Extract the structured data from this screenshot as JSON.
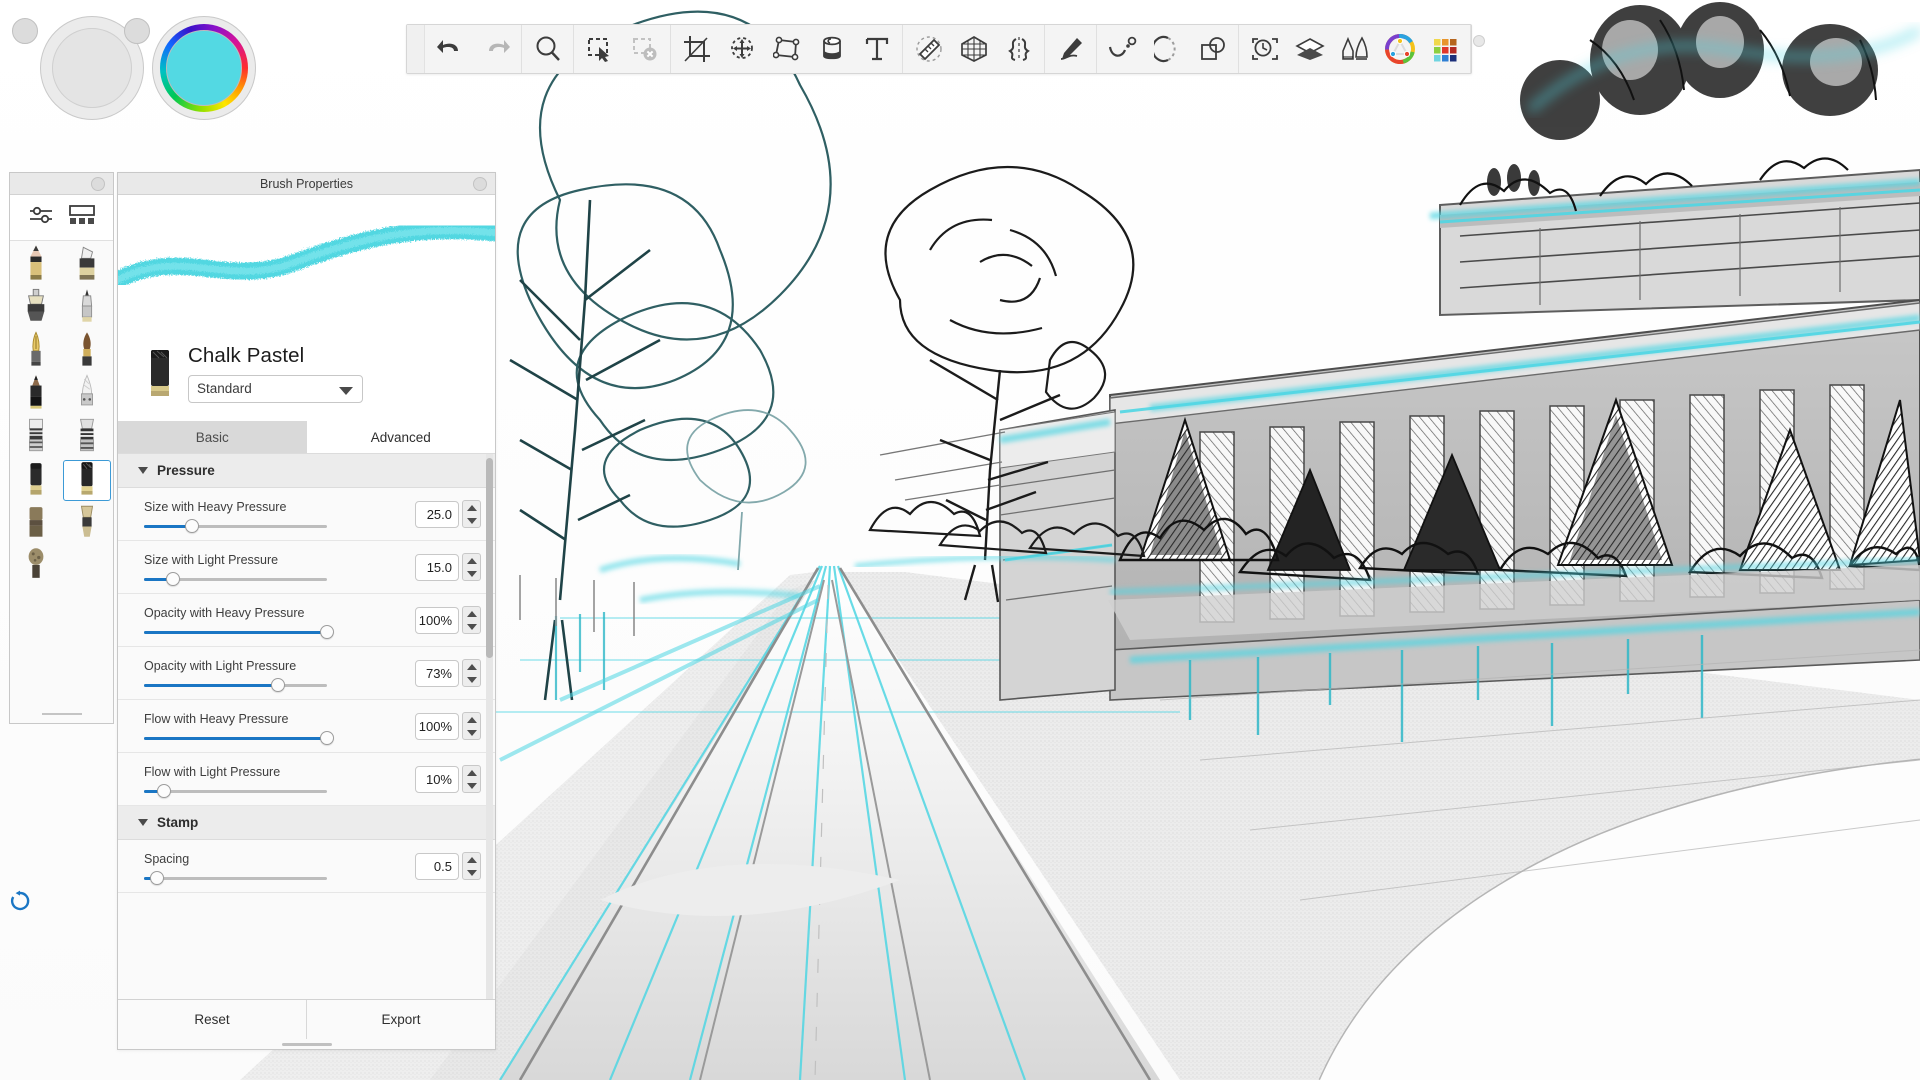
{
  "app": {
    "panel_title": "Brush Properties",
    "accent_color": "#1a76c4",
    "brush_color": "#4ad5e0"
  },
  "color_widgets": [
    {
      "name": "secondary-color-swatch",
      "color": "#e4e4e4",
      "has_ring": false
    },
    {
      "name": "primary-color-swatch",
      "color": "#53d9e3",
      "has_ring": true
    }
  ],
  "toolbar": {
    "groups": [
      {
        "items": [
          {
            "icon": "undo-icon",
            "label": "Undo"
          },
          {
            "icon": "redo-icon",
            "label": "Redo"
          }
        ]
      },
      {
        "items": [
          {
            "icon": "zoom-icon",
            "label": "Zoom"
          }
        ]
      },
      {
        "items": [
          {
            "icon": "select-icon",
            "label": "Select"
          },
          {
            "icon": "deselect-icon",
            "label": "Deselect"
          }
        ]
      },
      {
        "items": [
          {
            "icon": "crop-icon",
            "label": "Crop"
          },
          {
            "icon": "transform-move-icon",
            "label": "Transform"
          },
          {
            "icon": "perspective-icon",
            "label": "Perspective"
          },
          {
            "icon": "fill-bucket-icon",
            "label": "Fill"
          },
          {
            "icon": "text-icon",
            "label": "Text"
          }
        ]
      },
      {
        "items": [
          {
            "icon": "ruler-icon",
            "label": "Ruler"
          },
          {
            "icon": "perspective-grid-icon",
            "label": "Perspective Grid"
          },
          {
            "icon": "symmetry-icon",
            "label": "Symmetry"
          }
        ]
      },
      {
        "items": [
          {
            "icon": "pencil-edit-icon",
            "label": "Edit Stroke"
          }
        ]
      },
      {
        "items": [
          {
            "icon": "curve-node-icon",
            "label": "Curve"
          },
          {
            "icon": "ellipse-icon",
            "label": "Ellipse"
          },
          {
            "icon": "shape-combine-icon",
            "label": "Combine Shapes"
          }
        ]
      },
      {
        "items": [
          {
            "icon": "history-icon",
            "label": "History"
          },
          {
            "icon": "layers-icon",
            "label": "Layers"
          },
          {
            "icon": "brushes-icon",
            "label": "Brushes"
          },
          {
            "icon": "color-wheel-icon",
            "label": "Color Wheel"
          },
          {
            "icon": "palette-grid-icon",
            "label": "Palettes"
          }
        ]
      }
    ]
  },
  "brush_picker": {
    "mode_buttons": [
      {
        "icon": "sliders-icon",
        "label": "Settings View"
      },
      {
        "icon": "list-view-icon",
        "label": "List View"
      }
    ],
    "brushes": [
      {
        "name": "pencil",
        "selected": false
      },
      {
        "name": "marker-chisel",
        "selected": false
      },
      {
        "name": "airbrush",
        "selected": false
      },
      {
        "name": "technical-pen",
        "selected": false
      },
      {
        "name": "fountain-pen",
        "selected": false
      },
      {
        "name": "round-brush",
        "selected": false
      },
      {
        "name": "soft-pencil",
        "selected": false
      },
      {
        "name": "chalk-stick",
        "selected": false
      },
      {
        "name": "flat-bristle",
        "selected": false
      },
      {
        "name": "fan-bristle",
        "selected": false
      },
      {
        "name": "pastel-block",
        "selected": false
      },
      {
        "name": "chalk-pastel",
        "selected": true
      },
      {
        "name": "eraser-block",
        "selected": false
      },
      {
        "name": "blender",
        "selected": false
      },
      {
        "name": "sponge",
        "selected": false
      }
    ]
  },
  "brush_properties": {
    "title": "Brush Properties",
    "brush_name": "Chalk Pastel",
    "variant": "Standard",
    "tabs": [
      {
        "label": "Basic",
        "active": false
      },
      {
        "label": "Advanced",
        "active": true
      }
    ],
    "sections": [
      {
        "name": "Pressure",
        "expanded": true,
        "params": [
          {
            "label": "Size with Heavy Pressure",
            "value": "25.0",
            "fill_pct": 26
          },
          {
            "label": "Size with Light Pressure",
            "value": "15.0",
            "fill_pct": 16
          },
          {
            "label": "Opacity with Heavy Pressure",
            "value": "100%",
            "fill_pct": 100
          },
          {
            "label": "Opacity with Light Pressure",
            "value": "73%",
            "fill_pct": 73
          },
          {
            "label": "Flow with Heavy Pressure",
            "value": "100%",
            "fill_pct": 100
          },
          {
            "label": "Flow with Light Pressure",
            "value": "10%",
            "fill_pct": 11
          }
        ]
      },
      {
        "name": "Stamp",
        "expanded": true,
        "params": [
          {
            "label": "Spacing",
            "value": "0.5",
            "fill_pct": 7
          }
        ]
      }
    ],
    "footer_buttons": [
      {
        "label": "Reset"
      },
      {
        "label": "Export"
      }
    ]
  },
  "canvas": {
    "description": "Architectural perspective sketch of a museum building along a tree-lined boulevard, drawn in graphite with cyan chalk-pastel highlights",
    "sketch_ink": "#1b1b1b",
    "highlight": "#4fd6e3",
    "pavement": "#cfcfcf"
  },
  "status": {
    "refresh_icon": "refresh-icon"
  }
}
